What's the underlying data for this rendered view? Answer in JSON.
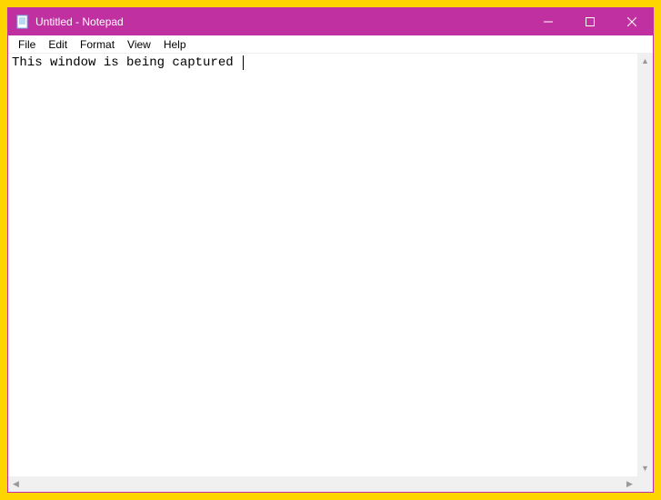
{
  "titlebar": {
    "title": "Untitled - Notepad"
  },
  "menu": {
    "items": [
      "File",
      "Edit",
      "Format",
      "View",
      "Help"
    ]
  },
  "editor": {
    "content": "This window is being captured "
  },
  "colors": {
    "capture_border": "#ffd500",
    "titlebar": "#c030a0"
  }
}
